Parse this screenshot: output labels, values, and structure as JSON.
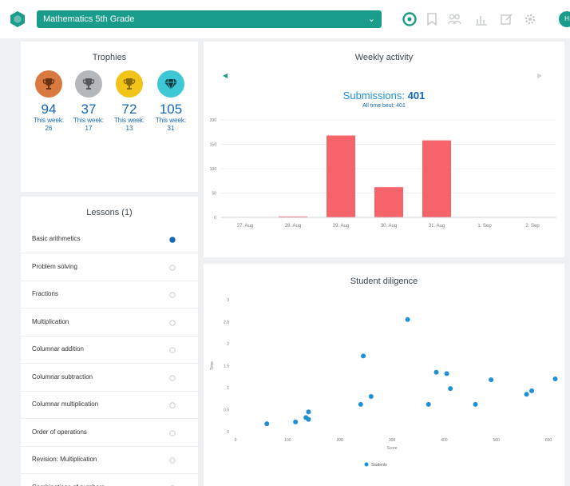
{
  "header": {
    "course": "Mathematics 5th Grade",
    "avatar_initials": "H"
  },
  "colors": {
    "brand": "#1a9c8c",
    "blue": "#1467b3",
    "bar": "#f4646a",
    "dot": "#1e90d6"
  },
  "trophies": {
    "title": "Trophies",
    "items": [
      {
        "kind": "bronze",
        "count": "94",
        "week_label": "This week:",
        "week_value": "26",
        "color": "#d9793f"
      },
      {
        "kind": "silver",
        "count": "37",
        "week_label": "This week:",
        "week_value": "17",
        "color": "#b5b8bb"
      },
      {
        "kind": "gold",
        "count": "72",
        "week_label": "This week:",
        "week_value": "13",
        "color": "#f2c318"
      },
      {
        "kind": "diamond",
        "count": "105",
        "week_label": "This week:",
        "week_value": "31",
        "color": "#3ec7d4"
      }
    ]
  },
  "lessons": {
    "title": "Lessons (1)",
    "items": [
      {
        "label": "Basic arithmetics",
        "active": true
      },
      {
        "label": "Problem solving",
        "active": false
      },
      {
        "label": "Fractions",
        "active": false
      },
      {
        "label": "Multiplication",
        "active": false
      },
      {
        "label": "Columnar addition",
        "active": false
      },
      {
        "label": "Columnar subtraction",
        "active": false
      },
      {
        "label": "Columnar multiplication",
        "active": false
      },
      {
        "label": "Order of operations",
        "active": false
      },
      {
        "label": "Revision: Multiplication",
        "active": false
      },
      {
        "label": "Combinations of numbers",
        "active": false
      }
    ]
  },
  "weekly": {
    "title": "Weekly activity",
    "submissions_label": "Submissions:",
    "submissions_value": "401",
    "best_text": "All time best: 401"
  },
  "diligence": {
    "title": "Student diligence"
  },
  "chart_data": [
    {
      "type": "bar",
      "title": "Weekly activity",
      "categories": [
        "27. Aug",
        "28. Aug",
        "29. Aug",
        "30. Aug",
        "31. Aug",
        "1. Sep",
        "2. Sep"
      ],
      "values": [
        0,
        2,
        168,
        62,
        158,
        0,
        0
      ],
      "ylim": [
        0,
        200
      ],
      "yticks": [
        0,
        50,
        100,
        150,
        200
      ],
      "grid": true
    },
    {
      "type": "scatter",
      "title": "Student diligence",
      "xlabel": "Score",
      "ylabel": "Time",
      "xlim": [
        0,
        600
      ],
      "ylim": [
        0,
        3
      ],
      "xticks": [
        0,
        100,
        200,
        300,
        400,
        500,
        600
      ],
      "yticks": [
        0,
        0.5,
        1,
        1.5,
        2,
        2.5,
        3
      ],
      "series": [
        {
          "name": "Students",
          "x": [
            60,
            115,
            135,
            140,
            140,
            240,
            245,
            260,
            330,
            370,
            385,
            405,
            412,
            460,
            490,
            558,
            568,
            613
          ],
          "y": [
            0.18,
            0.22,
            0.32,
            0.28,
            0.45,
            0.62,
            1.72,
            0.8,
            2.55,
            0.62,
            1.35,
            1.32,
            0.98,
            0.62,
            1.18,
            0.85,
            0.93,
            1.2
          ]
        }
      ]
    }
  ]
}
